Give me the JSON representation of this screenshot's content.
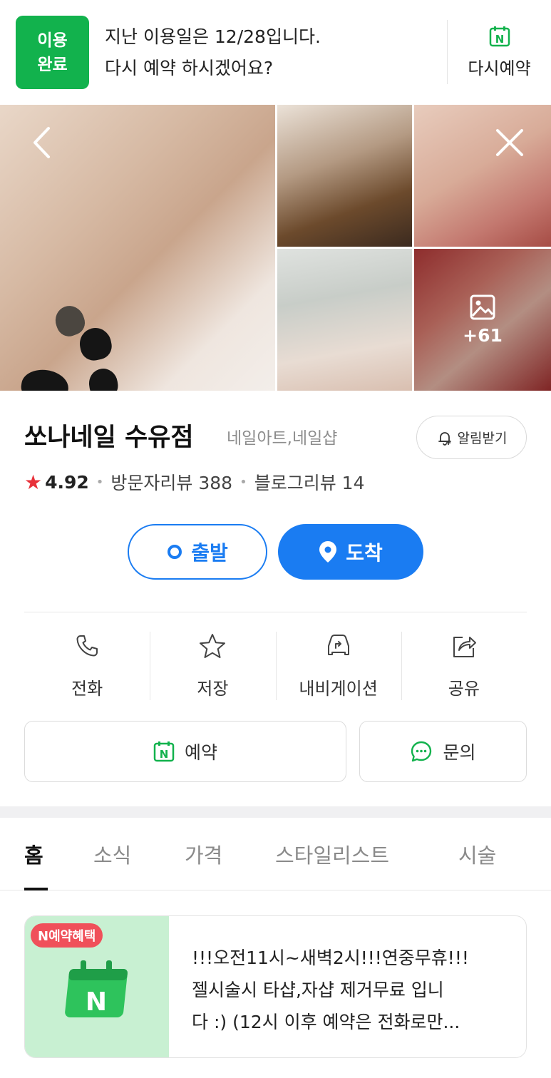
{
  "notice": {
    "badge_line1": "이용",
    "badge_line2": "완료",
    "message_line1": "지난 이용일은 12/28입니다.",
    "message_line2": "다시 예약 하시겠어요?",
    "rebook_label": "다시예약",
    "rebook_icon": "naver-calendar-icon",
    "brand_color": "#12b24d"
  },
  "photos": {
    "more_count": "+61",
    "back_icon": "chevron-left-icon",
    "close_icon": "close-icon",
    "more_icon": "image-icon"
  },
  "place": {
    "name": "쏘나네일 수유점",
    "category": "네일아트,네일샵",
    "alarm_label": "알림받기",
    "rating": "4.92",
    "visitor_reviews": "방문자리뷰 388",
    "blog_reviews": "블로그리뷰 14",
    "star_color": "#e8313a"
  },
  "route": {
    "depart_label": "출발",
    "arrive_label": "도착",
    "accent": "#1a7cf2"
  },
  "actions": [
    {
      "label": "전화",
      "icon": "phone-icon"
    },
    {
      "label": "저장",
      "icon": "star-outline-icon"
    },
    {
      "label": "내비게이션",
      "icon": "car-navigation-icon"
    },
    {
      "label": "공유",
      "icon": "share-icon"
    }
  ],
  "buttons": {
    "reserve_label": "예약",
    "inquiry_label": "문의"
  },
  "tabs": [
    {
      "label": "홈",
      "active": true
    },
    {
      "label": "소식",
      "active": false
    },
    {
      "label": "가격",
      "active": false
    },
    {
      "label": "스타일리스트",
      "active": false
    },
    {
      "label": "시술",
      "active": false
    }
  ],
  "promo": {
    "badge": "N예약혜택",
    "line1": "!!!오전11시~새벽2시!!!연중무휴!!!",
    "line2": "젤시술시 타샵,자샵 제거무료 입니",
    "line3": "다 :) (12시 이후 예약은 전화로만..."
  }
}
